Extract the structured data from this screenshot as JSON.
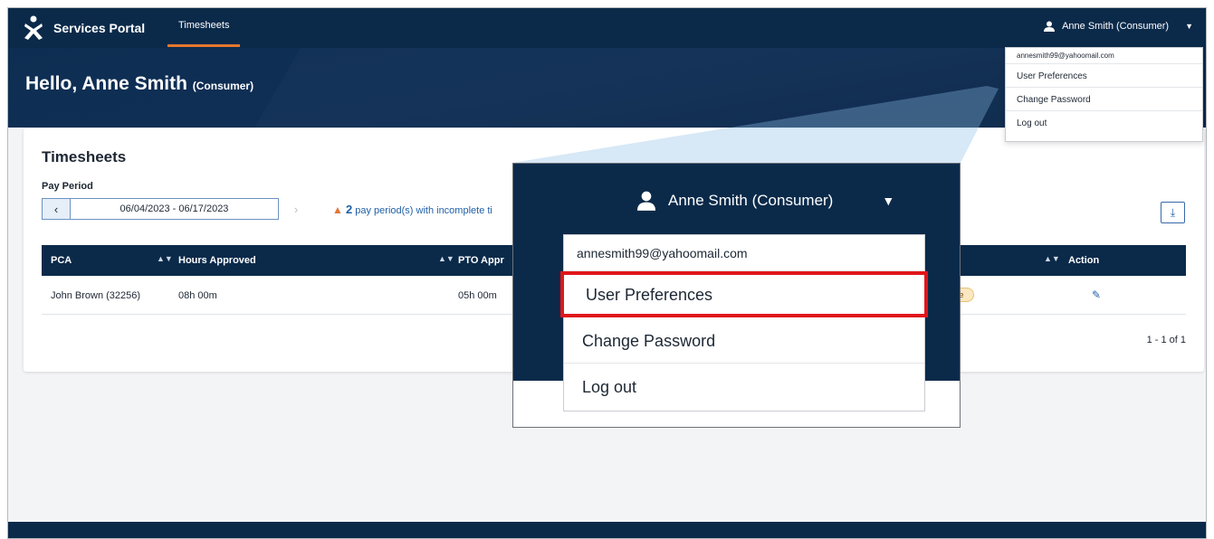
{
  "nav": {
    "brand": "Services Portal",
    "tab": "Timesheets",
    "user": "Anne Smith (Consumer)"
  },
  "hero": {
    "hello": "Hello,",
    "name": "Anne Smith",
    "role": "(Consumer)"
  },
  "timesheets": {
    "title": "Timesheets",
    "pay_period_label": "Pay Period",
    "pay_period": "06/04/2023 - 06/17/2023",
    "warning_count": "2",
    "warning_text": "pay period(s) with incomplete ti",
    "columns": [
      "PCA",
      "Hours Approved",
      "PTO Appr",
      "Action"
    ],
    "rows": [
      {
        "pca": "John Brown (32256)",
        "hours": "08h 00m",
        "pto": "05h 00m",
        "status": "te"
      }
    ],
    "pager": "1 - 1 of 1"
  },
  "user_dropdown": {
    "email": "annesmith99@yahoomail.com",
    "items": [
      "User Preferences",
      "Change Password",
      "Log out"
    ]
  },
  "colors": {
    "navy": "#0b2a4a",
    "accent": "#e5772f",
    "highlight": "#e0161b"
  }
}
